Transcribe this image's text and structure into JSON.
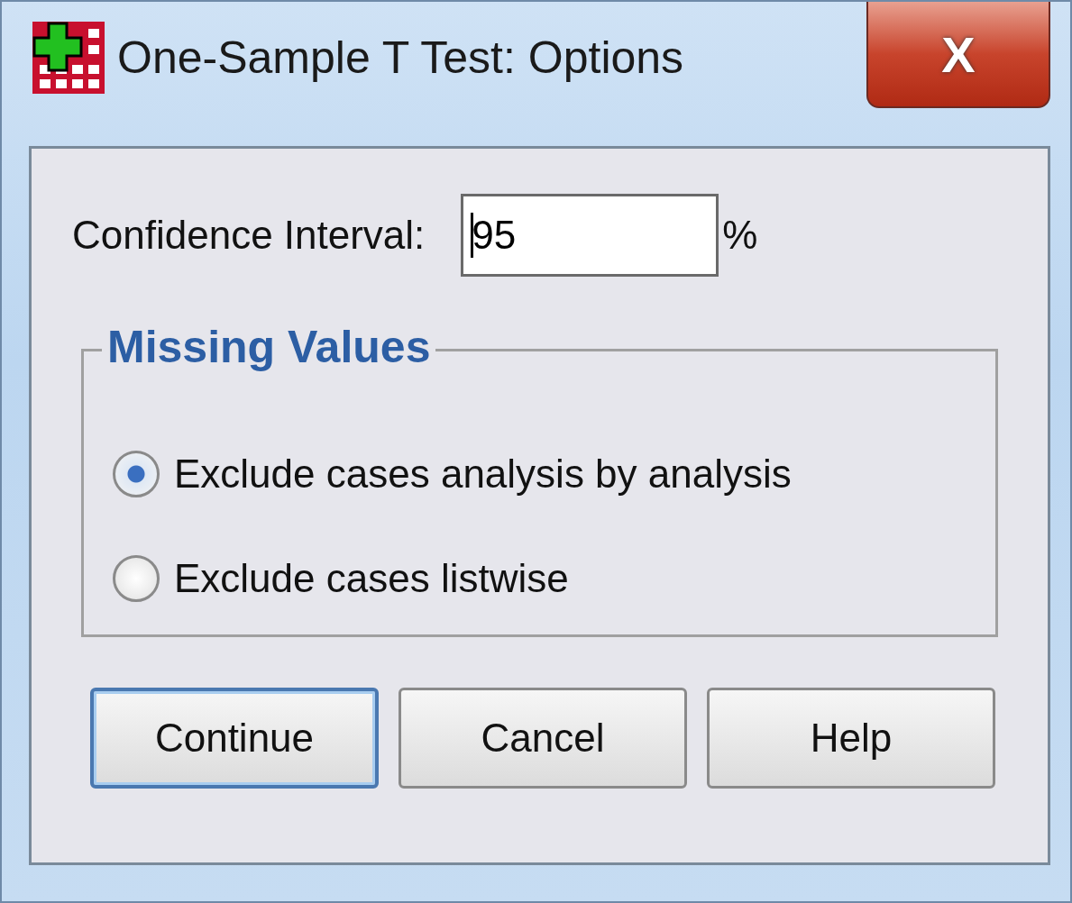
{
  "window": {
    "title": "One-Sample T Test: Options",
    "close": "X"
  },
  "confidence": {
    "label": "Confidence Interval:",
    "value": "95",
    "focused": true,
    "unit": "%"
  },
  "missing_values": {
    "title": "Missing Values",
    "options": [
      {
        "label": "Exclude cases analysis by analysis",
        "selected": true
      },
      {
        "label": "Exclude cases listwise",
        "selected": false
      }
    ]
  },
  "buttons": [
    {
      "label": "Continue",
      "default": true
    },
    {
      "label": "Cancel",
      "default": false
    },
    {
      "label": "Help",
      "default": false
    }
  ]
}
